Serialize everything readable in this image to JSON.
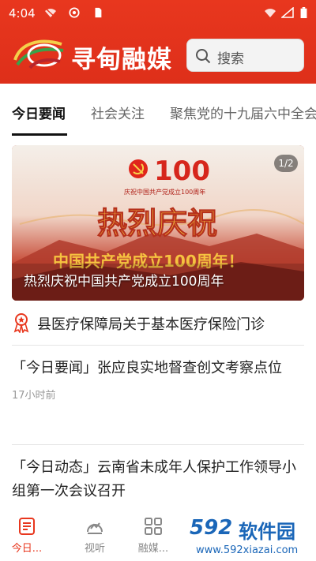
{
  "status_bar": {
    "time": "4:04"
  },
  "header": {
    "brand_name": "寻甸融媒",
    "search_placeholder": "搜索",
    "colors": {
      "primary": "#e8371e"
    }
  },
  "tabs": [
    {
      "label": "今日要闻",
      "active": true
    },
    {
      "label": "社会关注",
      "active": false
    },
    {
      "label": "聚焦党的十九届六中全会",
      "active": false
    }
  ],
  "banner": {
    "counter": "1/2",
    "caption": "热烈庆祝中国共产党成立100周年",
    "image_text": {
      "main": "热烈庆祝",
      "sub": "中国共产党成立100周年！",
      "small": "庆祝中国共产党成立100周年",
      "number": "100"
    }
  },
  "ticker": {
    "text": "县医疗保障局关于基本医疗保险门诊"
  },
  "news": [
    {
      "title": "「今日要闻」张应良实地督查创文考察点位",
      "meta": "17小时前"
    },
    {
      "title": "「今日动态」云南省未成年人保护工作领导小组第一次会议召开",
      "meta": ""
    }
  ],
  "bottom_nav": [
    {
      "label": "今日...",
      "icon": "news-icon",
      "active": true
    },
    {
      "label": "视听",
      "icon": "media-icon",
      "active": false
    },
    {
      "label": "融媒...",
      "icon": "apps-icon",
      "active": false
    }
  ],
  "watermark": {
    "number": "592",
    "name": "软件园",
    "url": "www.592xiazai.com"
  }
}
